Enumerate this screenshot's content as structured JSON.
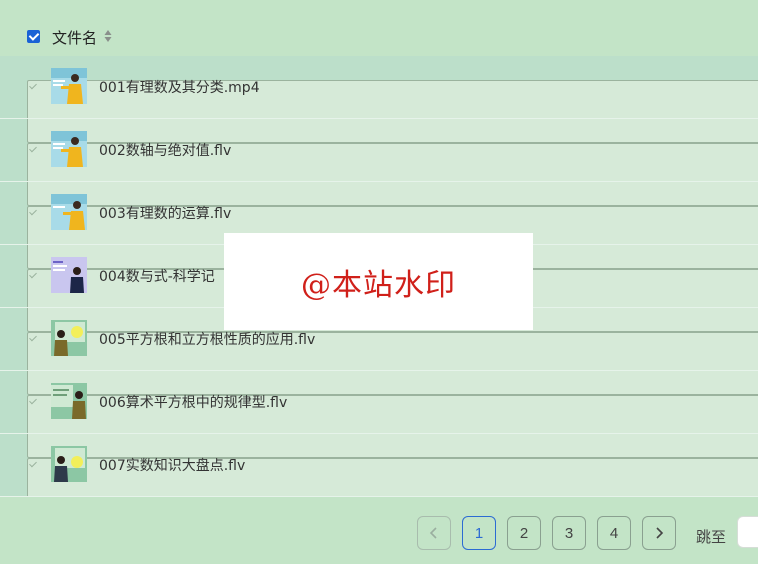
{
  "header": {
    "select_all_checked": true,
    "column_title": "文件名",
    "sort_icon": "sort-both-icon"
  },
  "files": [
    {
      "name": "001有理数及其分类.mp4",
      "thumb": "teacher-yellow-blue"
    },
    {
      "name": "002数轴与绝对值.flv",
      "thumb": "teacher-yellow-blue"
    },
    {
      "name": "003有理数的运算.flv",
      "thumb": "teacher-yellow-blue"
    },
    {
      "name": "004数与式-科学记",
      "thumb": "teacher-purple"
    },
    {
      "name": "005平方根和立方根性质的应用.flv",
      "thumb": "teacher-green-board"
    },
    {
      "name": "006算术平方根中的规律型.flv",
      "thumb": "teacher-green-board"
    },
    {
      "name": "007实数知识大盘点.flv",
      "thumb": "teacher-green-yellow"
    }
  ],
  "watermark": "@本站水印",
  "pagination": {
    "prev_icon": "chevron-left-icon",
    "next_icon": "chevron-right-icon",
    "pages": [
      "1",
      "2",
      "3",
      "4"
    ],
    "current_page": "1",
    "jump_label": "跳至",
    "jump_value": ""
  },
  "colors": {
    "background": "#c3e4c7",
    "list_background": "#bcdfca",
    "accent": "#1a62d6",
    "watermark_text": "#d0201a"
  }
}
